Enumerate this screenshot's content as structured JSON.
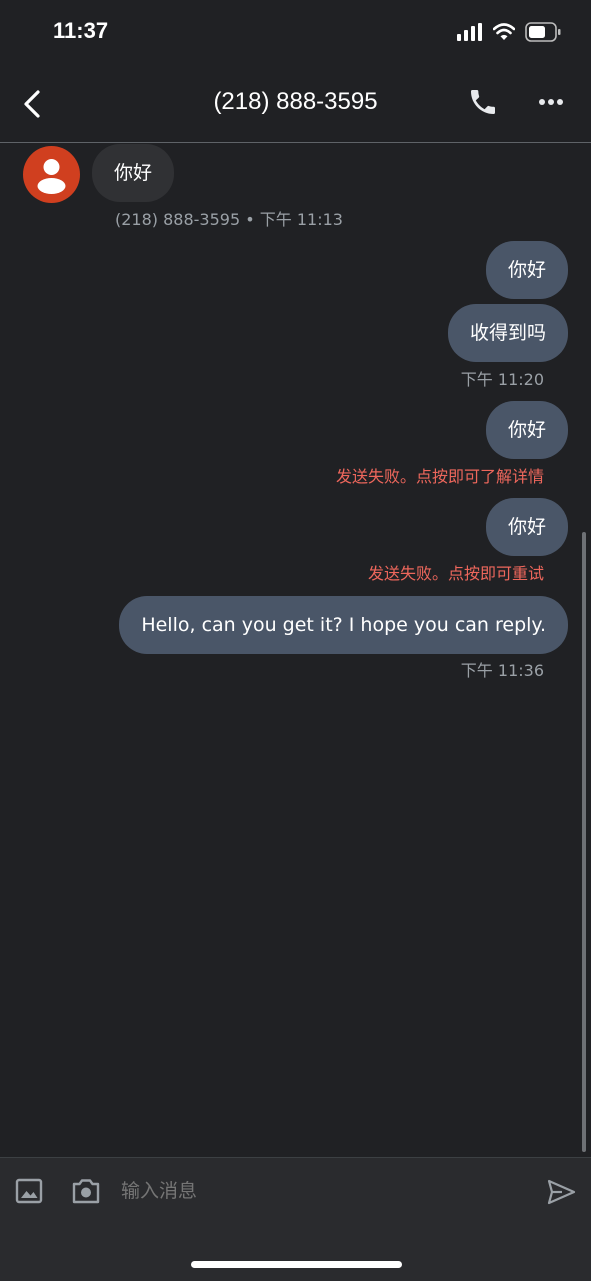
{
  "status_bar": {
    "time": "11:37",
    "icons": [
      "signal-icon",
      "wifi-icon",
      "battery-icon"
    ]
  },
  "header": {
    "back_icon": "chevron-left-icon",
    "title": "(218) 888-3595",
    "call_icon": "phone-icon",
    "more_icon": "more-icon"
  },
  "messages": [
    {
      "direction": "incoming",
      "text": "你好",
      "meta": "(218) 888-3595 • 下午 11:13"
    },
    {
      "direction": "outgoing",
      "text": "你好"
    },
    {
      "direction": "outgoing",
      "text": "收得到吗",
      "meta": "下午 11:20"
    },
    {
      "direction": "outgoing",
      "text": "你好",
      "error": "发送失败。点按即可了解详情"
    },
    {
      "direction": "outgoing",
      "text": "你好",
      "error": "发送失败。点按即可重试"
    },
    {
      "direction": "outgoing",
      "text": "Hello, can you get it? I hope you can reply.",
      "meta": "下午 11:36"
    }
  ],
  "composer": {
    "placeholder": "输入消息",
    "image_icon": "image-icon",
    "camera_icon": "camera-icon",
    "send_icon": "send-icon"
  },
  "colors": {
    "background": "#202124",
    "incoming_bubble": "#303134",
    "outgoing_bubble": "#4a5668",
    "error": "#ee675c",
    "avatar": "#d03f1f"
  }
}
